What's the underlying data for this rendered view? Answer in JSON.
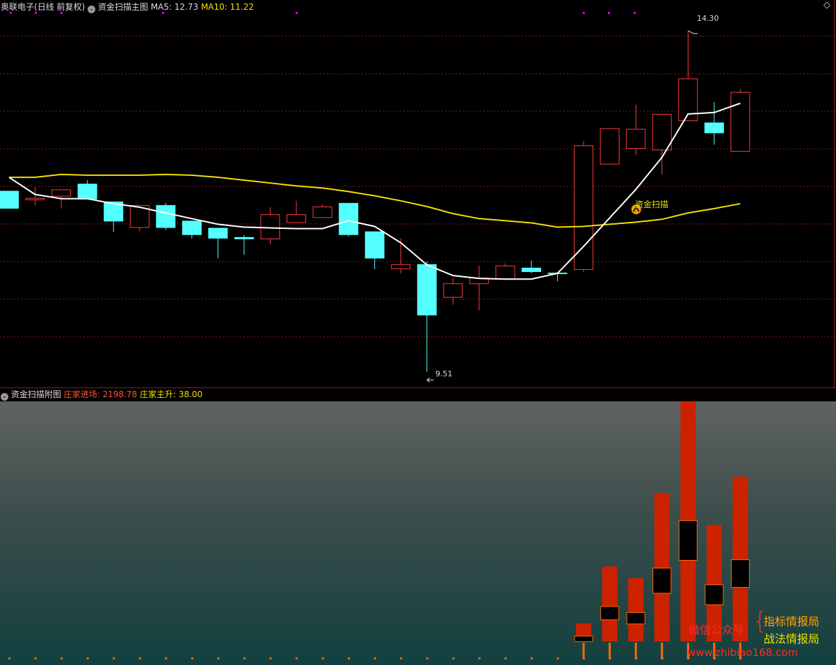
{
  "header": {
    "stock": "奥联电子",
    "period": "(日线 前复权)",
    "indicator": "资金扫描主图",
    "ma5_label": "MA5: 12.73",
    "ma10_label": "MA10: 11.22"
  },
  "sub_header": {
    "indicator": "资金扫描附图",
    "entry_label": "庄家进场: 2198.78",
    "rise_label": "庄家主升: 38.00"
  },
  "annotations": {
    "high_label": "14.30",
    "low_label": "9.51",
    "signal_label": "资金扫描"
  },
  "watermark": {
    "account": "微信公众号",
    "brace": "{",
    "line1": "指标情报局",
    "line2": "战法情报局",
    "url": "www.zhibiao168.com"
  },
  "colors": {
    "up": "#ff3b3b",
    "down": "#54ffff",
    "ma5": "#ffffff",
    "ma10": "#f0e000",
    "bar": "#cc2200",
    "grid": "#8b1a1a",
    "marker": "#e000e0"
  },
  "chart_data": [
    {
      "type": "candlestick",
      "title": "资金扫描主图",
      "ylim": [
        9.3,
        14.5
      ],
      "candles": [
        {
          "o": 12.05,
          "h": 12.05,
          "c": 11.8,
          "l": 11.8
        },
        {
          "o": 11.92,
          "h": 12.1,
          "c": 11.95,
          "l": 11.85
        },
        {
          "o": 11.97,
          "h": 12.07,
          "c": 12.07,
          "l": 11.8
        },
        {
          "o": 12.15,
          "h": 12.2,
          "c": 11.93,
          "l": 11.93
        },
        {
          "o": 11.9,
          "h": 11.9,
          "c": 11.62,
          "l": 11.47
        },
        {
          "o": 11.53,
          "h": 11.85,
          "c": 11.85,
          "l": 11.48
        },
        {
          "o": 11.85,
          "h": 11.88,
          "c": 11.53,
          "l": 11.5
        },
        {
          "o": 11.63,
          "h": 11.63,
          "c": 11.43,
          "l": 11.38
        },
        {
          "o": 11.53,
          "h": 11.53,
          "c": 11.38,
          "l": 11.1
        },
        {
          "o": 11.4,
          "h": 11.43,
          "c": 11.37,
          "l": 11.15
        },
        {
          "o": 11.37,
          "h": 11.82,
          "c": 11.72,
          "l": 11.3
        },
        {
          "o": 11.6,
          "h": 11.91,
          "c": 11.72,
          "l": 11.6
        },
        {
          "o": 11.67,
          "h": 11.86,
          "c": 11.83,
          "l": 11.67
        },
        {
          "o": 11.88,
          "h": 11.88,
          "c": 11.43,
          "l": 11.41
        },
        {
          "o": 11.48,
          "h": 11.48,
          "c": 11.1,
          "l": 10.95
        },
        {
          "o": 10.95,
          "h": 11.38,
          "c": 11.02,
          "l": 10.89
        },
        {
          "o": 11.02,
          "h": 11.06,
          "c": 10.3,
          "l": 9.51
        },
        {
          "o": 10.55,
          "h": 10.83,
          "c": 10.75,
          "l": 10.45
        },
        {
          "o": 10.74,
          "h": 11.0,
          "c": 10.83,
          "l": 10.37
        },
        {
          "o": 10.81,
          "h": 11.03,
          "c": 11.0,
          "l": 10.81
        },
        {
          "o": 10.97,
          "h": 11.07,
          "c": 10.91,
          "l": 10.89
        },
        {
          "o": 10.9,
          "h": 10.91,
          "c": 10.89,
          "l": 10.78
        },
        {
          "o": 10.94,
          "h": 12.75,
          "c": 12.69,
          "l": 10.91
        },
        {
          "o": 12.42,
          "h": 12.93,
          "c": 12.93,
          "l": 12.42
        },
        {
          "o": 12.64,
          "h": 13.26,
          "c": 12.92,
          "l": 12.55
        },
        {
          "o": 12.62,
          "h": 13.13,
          "c": 13.13,
          "l": 12.28
        },
        {
          "o": 13.03,
          "h": 14.3,
          "c": 13.63,
          "l": 13.03
        },
        {
          "o": 13.01,
          "h": 13.3,
          "c": 12.86,
          "l": 12.7
        },
        {
          "o": 12.6,
          "h": 13.48,
          "c": 13.44,
          "l": 12.6
        }
      ],
      "ma5": [
        12.24,
        12.0,
        11.94,
        11.94,
        11.87,
        11.82,
        11.74,
        11.66,
        11.58,
        11.54,
        11.53,
        11.52,
        11.52,
        11.63,
        11.55,
        11.32,
        11.01,
        10.86,
        10.82,
        10.81,
        10.81,
        10.89,
        11.27,
        11.67,
        12.07,
        12.52,
        13.13,
        13.15,
        13.28
      ],
      "ma10": [
        12.24,
        12.24,
        12.28,
        12.27,
        12.27,
        12.27,
        12.28,
        12.27,
        12.24,
        12.2,
        12.16,
        12.12,
        12.09,
        12.04,
        11.98,
        11.91,
        11.83,
        11.73,
        11.66,
        11.63,
        11.6,
        11.54,
        11.55,
        11.58,
        11.61,
        11.65,
        11.74,
        11.8,
        11.87
      ],
      "signal_index": 24
    },
    {
      "type": "bar",
      "title": "资金扫描附图",
      "ylim": [
        0,
        2198.78
      ],
      "start_index": 22,
      "values": [
        233.23,
        736.95,
        633.64,
        1388.55,
        2198.78,
        1105.43,
        1532.26
      ]
    }
  ]
}
